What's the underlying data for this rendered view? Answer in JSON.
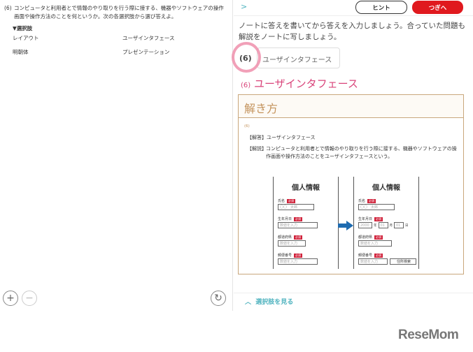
{
  "question": {
    "number": "(6)",
    "text": "コンピュータと利用者とで情報のやり取りを行う際に接する、機器やソフトウェアの操作画面や操作方法のことを何というか。次の各選択肢から選び答えよ。",
    "choices_label": "▼選択肢",
    "choices": [
      "レイアウト",
      "ユーザインタフェース",
      "明朝体",
      "プレゼンテーション"
    ]
  },
  "left_controls": {
    "zoom_in": "+",
    "zoom_out": "−",
    "rotate": "↻"
  },
  "header": {
    "back": ">",
    "hint_label": "ヒント",
    "next_label": "つぎへ"
  },
  "instruction": "ノートに答えを書いてから答えを入力しましょう。合っていた問題も解説をノートに写しましょう。",
  "answer": {
    "number": "(6)",
    "value": "ユーザインタフェース"
  },
  "result": {
    "number": "(6)",
    "text": "ユーザインタフェース"
  },
  "explanation": {
    "title": "解き方",
    "number": "(6)",
    "answer_tag": "【解答】",
    "answer": "ユーザインタフェース",
    "explain_tag": "【解説】",
    "explain": "コンピュータと利用者とで情報のやり取りを行う際に接する、機器やソフトウェアの操作画面や操作方法のことをユーザインタフェースという。"
  },
  "figure": {
    "title": "個人情報",
    "required": "必須",
    "fields": [
      "氏名",
      "生年月日",
      "都道府県",
      "郵便番号"
    ],
    "name_ph": "〇〇　太郎",
    "input_ph": "数値を入力",
    "year_ph": "2000",
    "month_ph": "01",
    "day_ph": "01",
    "year": "年",
    "month": "月",
    "day": "日",
    "search": "住所検索"
  },
  "footer": {
    "show_choices": "選択肢を見る"
  },
  "logo": "ReseMom",
  "colors": {
    "red": "#e0191e",
    "pink": "#d9447a",
    "teal": "#4fb3bf",
    "tan": "#c9a77c"
  }
}
